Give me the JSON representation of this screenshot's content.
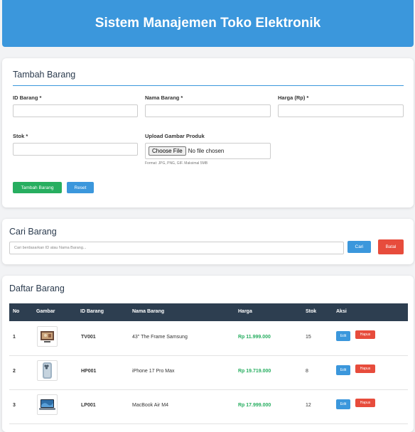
{
  "header": {
    "title": "Sistem Manajemen Toko Elektronik"
  },
  "add_form": {
    "title": "Tambah Barang",
    "id_label": "ID Barang *",
    "name_label": "Nama Barang *",
    "price_label": "Harga (Rp) *",
    "stock_label": "Stok *",
    "upload_label": "Upload Gambar Produk",
    "file_button": "Choose File",
    "file_status": "No file chosen",
    "file_hint": "Format: JPG, PNG, GIF. Maksimal 5MB",
    "submit_label": "Tambah Barang",
    "reset_label": "Reset"
  },
  "search": {
    "title": "Cari Barang",
    "placeholder": "Cari berdasarkan ID atau Nama Barang...",
    "search_label": "Cari",
    "cancel_label": "Batal"
  },
  "list": {
    "title": "Daftar Barang",
    "columns": [
      "No",
      "Gambar",
      "ID Barang",
      "Nama Barang",
      "Harga",
      "Stok",
      "Aksi"
    ],
    "rows": [
      {
        "no": "1",
        "id": "TV001",
        "name": "43\" The Frame Samsung",
        "price": "Rp 11.999.000",
        "stock": "15",
        "edit": "Edit",
        "delete": "Hapus",
        "image": "tv-icon"
      },
      {
        "no": "2",
        "id": "HP001",
        "name": "iPhone 17 Pro Max",
        "price": "Rp 19.719.000",
        "stock": "8",
        "edit": "Edit",
        "delete": "Hapus",
        "image": "phone-icon"
      },
      {
        "no": "3",
        "id": "LP001",
        "name": "MacBook Air M4",
        "price": "Rp 17.999.000",
        "stock": "12",
        "edit": "Edit",
        "delete": "Hapus",
        "image": "laptop-icon"
      }
    ]
  },
  "colors": {
    "primary": "#3b97dc",
    "success": "#27ae60",
    "danger": "#e74c3c",
    "table_header": "#2d3e50"
  }
}
